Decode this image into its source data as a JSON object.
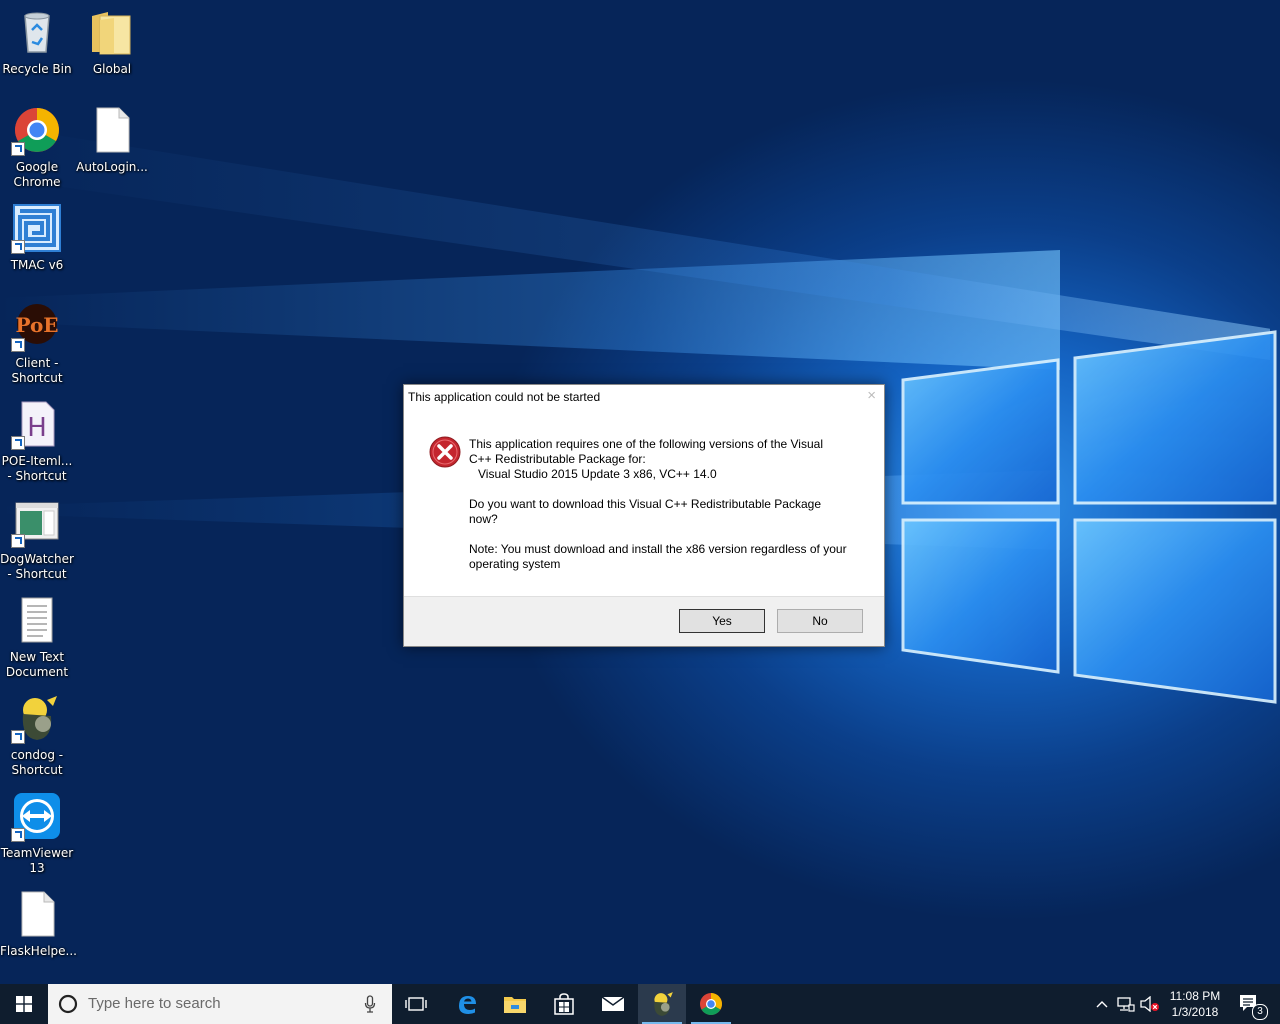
{
  "desktop": {
    "icons": [
      {
        "id": "recycle-bin",
        "label": "Recycle Bin"
      },
      {
        "id": "global",
        "label": "Global"
      },
      {
        "id": "google-chrome",
        "label": "Google\nChrome"
      },
      {
        "id": "autologin",
        "label": "AutoLogin..."
      },
      {
        "id": "tmac",
        "label": "TMAC v6"
      },
      {
        "id": "poe-client",
        "label": "Client -\nShortcut"
      },
      {
        "id": "poe-itemlevel",
        "label": "POE-Iteml...\n- Shortcut"
      },
      {
        "id": "dogwatcher",
        "label": "DogWatcher\n- Shortcut"
      },
      {
        "id": "new-text-document",
        "label": "New Text\nDocument"
      },
      {
        "id": "condog",
        "label": "condog -\nShortcut"
      },
      {
        "id": "teamviewer",
        "label": "TeamViewer\n13"
      },
      {
        "id": "flaskhelper",
        "label": "FlaskHelpe..."
      }
    ],
    "poe_logo_text": "PoE",
    "html_file_letter": "H"
  },
  "dialog": {
    "title": "This application could not be started",
    "close_glyph": "×",
    "icon": "error-icon",
    "message_lines": [
      "This application requires one of the following versions of the Visual C++ Redistributable Package for:",
      "Visual Studio 2015 Update 3 x86, VC++ 14.0",
      "Do you want to download this Visual C++ Redistributable Package now?",
      "Note: You must download and install the x86 version regardless of your operating system"
    ],
    "yes_label": "Yes",
    "no_label": "No"
  },
  "taskbar": {
    "search_placeholder": "Type here to search",
    "time": "11:08 PM",
    "date": "1/3/2018",
    "notification_count": "3",
    "colors": {
      "background": "#0f1d2e",
      "accent": "#76b9ed"
    }
  }
}
